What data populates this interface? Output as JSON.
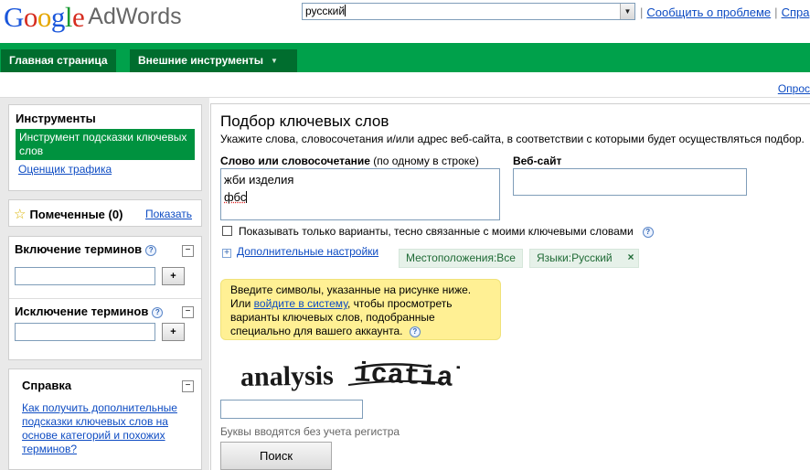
{
  "header": {
    "logo_google_letters": [
      "G",
      "o",
      "o",
      "g",
      "l",
      "e"
    ],
    "logo_product": "AdWords",
    "language_value": "русский",
    "links": [
      "Сообщить о проблеме",
      "Спра"
    ]
  },
  "nav": {
    "tabs": [
      {
        "label": "Главная страница"
      },
      {
        "label": "Внешние инструменты"
      }
    ],
    "right_link": "Опрос"
  },
  "sidebar": {
    "tools_title": "Инструменты",
    "tools_items": [
      "Инструмент подсказки ключевых слов",
      "Оценщик трафика"
    ],
    "starred_label": "Помеченные (0)",
    "starred_show": "Показать",
    "include_terms": "Включение терминов",
    "exclude_terms": "Исключение терминов",
    "add_label": "+",
    "collapse_label": "−",
    "help_title": "Справка",
    "help_link": "Как получить дополнительные подсказки ключевых слов на основе категорий и похожих терминов?",
    "help_q": "?"
  },
  "main": {
    "title": "Подбор ключевых слов",
    "subtitle": "Укажите слова, словосочетания и/или адрес веб-сайта, в соответствии с которыми будет осуществляться подбор.",
    "kw_label_bold": "Слово или словосочетание",
    "kw_label_hint": "(по одному в строке)",
    "kw_lines": [
      "жби изделия",
      "фбс"
    ],
    "web_label": "Веб-сайт",
    "checkbox_label": "Показывать только варианты, тесно связанные с моими ключевыми словами",
    "advanced_label": "Дополнительные настройки",
    "location_chip": "Местоположения:Все",
    "language_chip": "Языки:Русский",
    "chip_remove": "×",
    "notice_line1": "Введите символы, указанные на рисунке ниже.",
    "notice_pre": "Или ",
    "notice_link": "войдите в систему",
    "notice_post": ", чтобы просмотреть варианты ключевых слов, подобранные специально для вашего аккаунта.",
    "captcha_words": [
      "analysis",
      "icatial"
    ],
    "captcha_hint": "Буквы вводятся без учета регистра",
    "search_button": "Поиск"
  },
  "colors": {
    "nav_green": "#00a14b",
    "tab_dark_green": "#006d2e",
    "active_tool": "#00923f",
    "link_blue": "#0e4cc3",
    "notice_yellow": "#fff094",
    "chip_bg": "#e6f1e9",
    "sidebar_bg": "#e9e9e9"
  }
}
